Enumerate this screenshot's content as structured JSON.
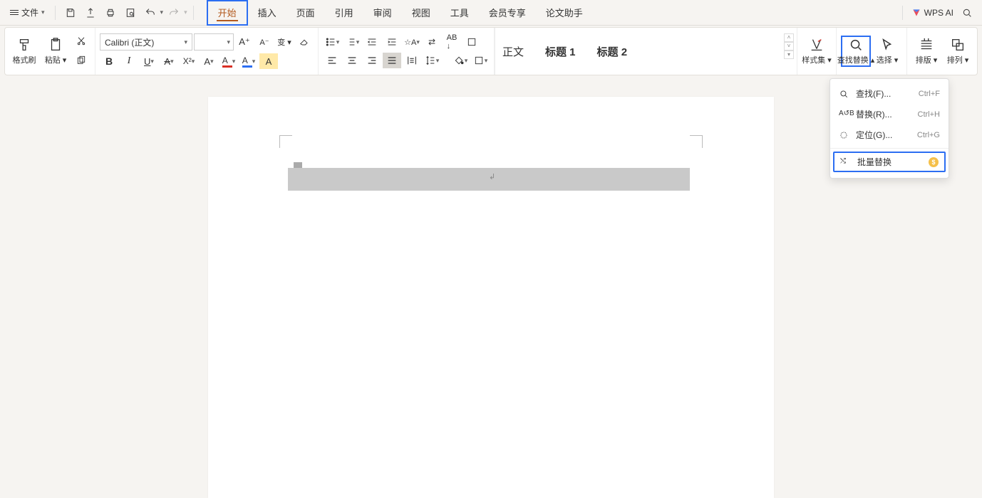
{
  "menubar": {
    "file_label": "文件",
    "tabs": [
      "开始",
      "插入",
      "页面",
      "引用",
      "审阅",
      "视图",
      "工具",
      "会员专享",
      "论文助手"
    ],
    "active_tab": 0,
    "wps_ai_label": "WPS AI"
  },
  "ribbon": {
    "format_painter": "格式刷",
    "paste": "粘贴",
    "font_name": "Calibri (正文)",
    "font_size": "",
    "styles": {
      "normal": "正文",
      "h1": "标题 1",
      "h2": "标题 2"
    },
    "styles_label": "样式集",
    "find_replace": "查找替换",
    "select": "选择",
    "layout": "排版",
    "arrange": "排列"
  },
  "dropdown": {
    "items": [
      {
        "icon": "search",
        "label": "查找(F)...",
        "shortcut": "Ctrl+F"
      },
      {
        "icon": "replace",
        "label": "替换(R)...",
        "shortcut": "Ctrl+H"
      },
      {
        "icon": "goto",
        "label": "定位(G)...",
        "shortcut": "Ctrl+G"
      }
    ],
    "batch": {
      "label": "批量替换"
    }
  }
}
